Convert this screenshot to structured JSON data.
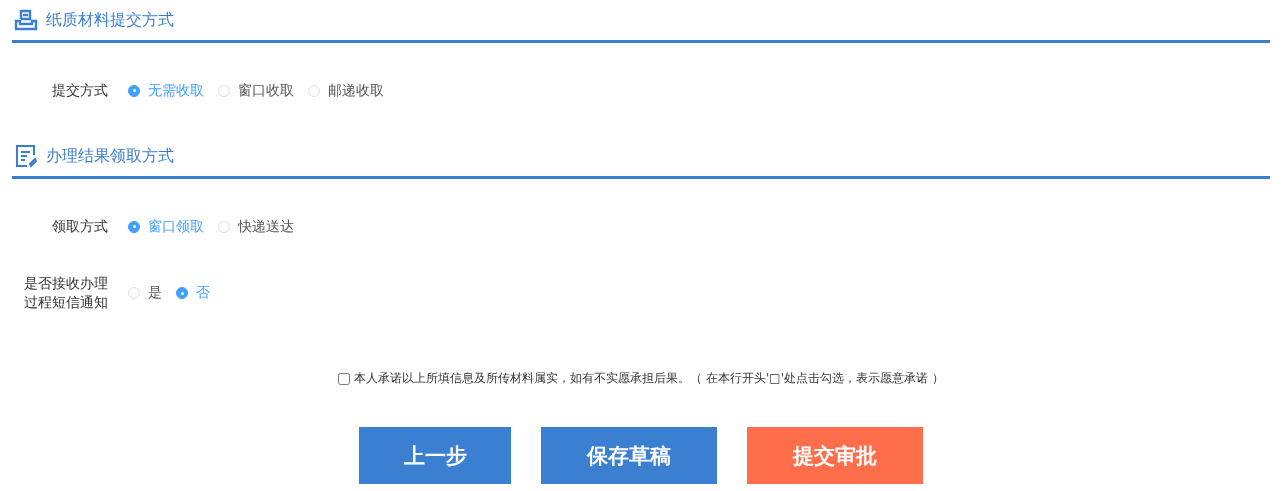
{
  "sections": [
    {
      "title": "纸质材料提交方式",
      "fields": [
        {
          "label": "提交方式",
          "options": [
            {
              "label": "无需收取",
              "selected": true
            },
            {
              "label": "窗口收取",
              "selected": false
            },
            {
              "label": "邮递收取",
              "selected": false
            }
          ]
        }
      ]
    },
    {
      "title": "办理结果领取方式",
      "fields": [
        {
          "label": "领取方式",
          "options": [
            {
              "label": "窗口领取",
              "selected": true
            },
            {
              "label": "快递送达",
              "selected": false
            }
          ]
        },
        {
          "label": "是否接收办理过程短信通知",
          "options": [
            {
              "label": "是",
              "selected": false
            },
            {
              "label": "否",
              "selected": true
            }
          ]
        }
      ]
    }
  ],
  "promise": {
    "checked": false,
    "text": "本人承诺以上所填信息及所传材料属实，如有不实愿承担后果。（ 在本行开头'□'处点击勾选，表示愿意承诺 ）"
  },
  "buttons": [
    {
      "label": "上一步",
      "kind": "primary"
    },
    {
      "label": "保存草稿",
      "kind": "primary"
    },
    {
      "label": "提交审批",
      "kind": "danger"
    }
  ]
}
